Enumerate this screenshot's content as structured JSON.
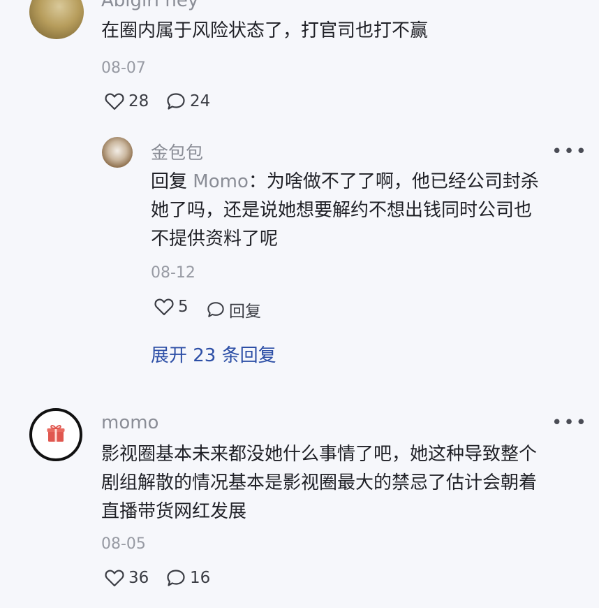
{
  "comments": [
    {
      "username": "Abigirl hey",
      "text": "在圈内属于风险状态了，打官司也打不赢",
      "date": "08-07",
      "likes": "28",
      "replies_count": "24",
      "more_icon": "more-icon",
      "sub_reply": {
        "username": "金包包",
        "reply_prefix": "回复",
        "reply_to": "Momo",
        "text_lines": [
          "：为啥做不了了啊，他已经公司封杀",
          "她了吗，还是说她想要解约不想出钱同时公司也",
          "不提供资料了呢"
        ],
        "date": "08-12",
        "likes": "5",
        "reply_label": "回复"
      },
      "expand_label": "展开 23 条回复"
    },
    {
      "username": "momo",
      "text_lines": [
        "影视圈基本未来都没她什么事情了吧，她这种导致整个",
        "剧组解散的情况基本是影视圈最大的禁忌了估计会朝着",
        "直播带货网红发展"
      ],
      "date": "08-05",
      "likes": "36",
      "replies_count": "16"
    }
  ],
  "icons": {
    "like": "heart-outline-icon",
    "comment": "speech-bubble-icon",
    "more": "ellipsis-icon",
    "gift": "gift-icon"
  },
  "colors": {
    "background": "#f6f7fb",
    "username": "#8a8d96",
    "link": "#2d4fa6",
    "gift_red": "#e0574f"
  }
}
